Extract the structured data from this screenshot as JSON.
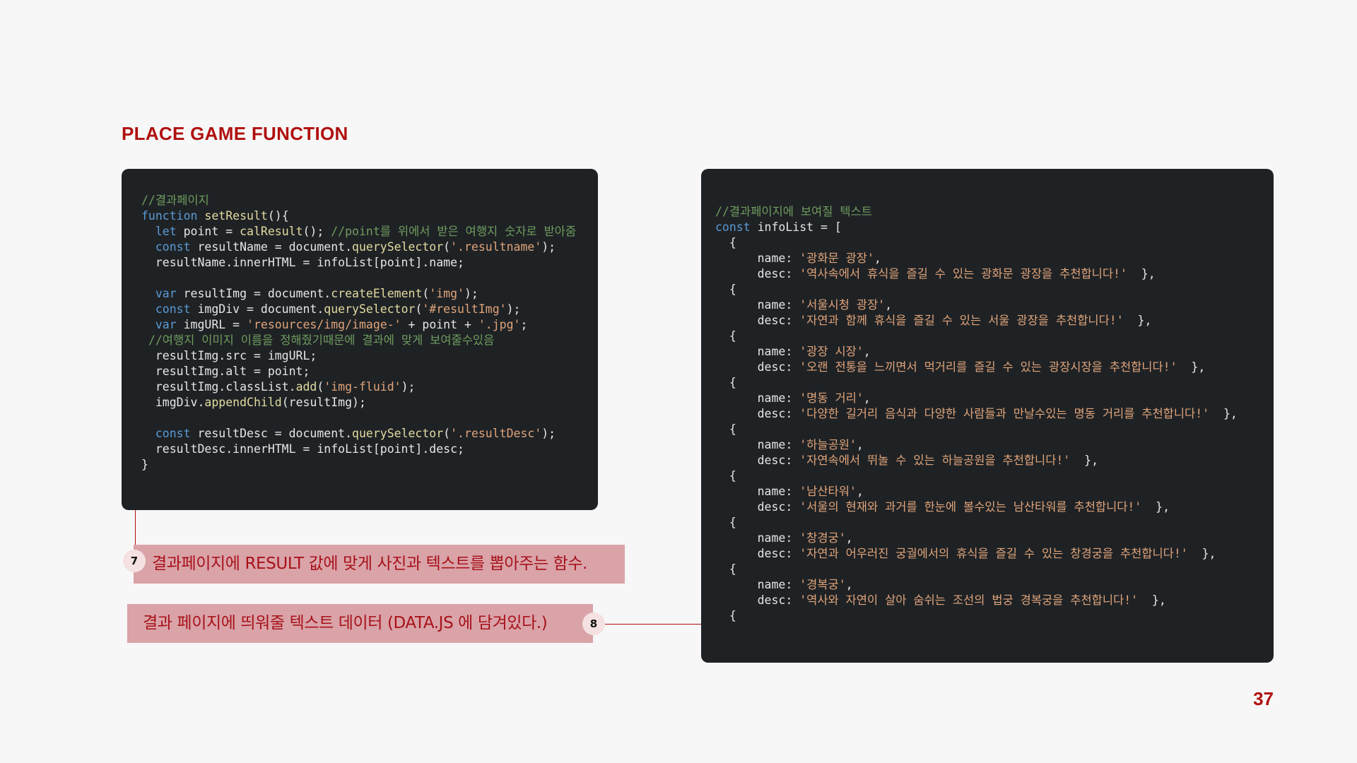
{
  "slide": {
    "title": "PLACE GAME FUNCTION",
    "page_number": "37",
    "accent_color": "#b01010",
    "panel_color": "#1f2225",
    "callout_color": "#d9a3a8"
  },
  "left_code": {
    "l1": "//결과페이지",
    "l2_kw": "function",
    "l2_fn": "setResult",
    "l2_rest": "(){",
    "l3_kw": "let",
    "l3_a": " point = ",
    "l3_fn": "calResult",
    "l3_b": "(); ",
    "l3_cm": "//point를 위에서 받은 여행지 숫자로 받아줌",
    "l4_kw": "const",
    "l4_a": " resultName = document.",
    "l4_fn": "querySelector",
    "l4_b": "(",
    "l4_st": "'.resultname'",
    "l4_c": ");",
    "l5": "resultName.innerHTML = infoList[point].name;",
    "l7_kw": "var",
    "l7_a": " resultImg = document.",
    "l7_fn": "createElement",
    "l7_b": "(",
    "l7_st": "'img'",
    "l7_c": ");",
    "l8_kw": "const",
    "l8_a": " imgDiv = document.",
    "l8_fn": "querySelector",
    "l8_b": "(",
    "l8_st": "'#resultImg'",
    "l8_c": ");",
    "l9_kw": "var",
    "l9_a": " imgURL = ",
    "l9_st": "'resources/img/image-'",
    "l9_b": " + point + ",
    "l9_st2": "'.jpg'",
    "l9_c": ";",
    "l10": "//여행지 이미지 이름을 정해줬기때문에 결과에 맞게 보여줄수있음",
    "l11": "resultImg.src = imgURL;",
    "l12": "resultImg.alt = point;",
    "l13_a": "resultImg.classList.",
    "l13_fn": "add",
    "l13_b": "(",
    "l13_st": "'img-fluid'",
    "l13_c": ");",
    "l14_a": "imgDiv.",
    "l14_fn": "appendChild",
    "l14_b": "(resultImg);",
    "l16_kw": "const",
    "l16_a": " resultDesc = document.",
    "l16_fn": "querySelector",
    "l16_b": "(",
    "l16_st": "'.resultDesc'",
    "l16_c": ");",
    "l17": "resultDesc.innerHTML = infoList[point].desc;",
    "l18": "}"
  },
  "right_code": {
    "comment": "//결과페이지에 보여질 텍스트",
    "decl_kw": "const",
    "decl_rest": " infoList = [",
    "open_brace": "{",
    "name_key": "name: ",
    "desc_key": "desc: ",
    "close_suffix": "  },",
    "items": [
      {
        "name": "'광화문 광장'",
        "desc": "'역사속에서 휴식을 즐길 수 있는 광화문 광장을 추천합니다!'"
      },
      {
        "name": "'서울시청 광장'",
        "desc": "'자연과 함께 휴식을 즐길 수 있는 서울 광장을 추천합니다!'"
      },
      {
        "name": "'광장 시장'",
        "desc": "'오랜 전통을 느끼면서 먹거리를 즐길 수 있는 광장시장을 추천합니다!'"
      },
      {
        "name": "'명동 거리'",
        "desc": "'다양한 길거리 음식과 다양한 사람들과 만날수있는 명동 거리를 추천합니다!'"
      },
      {
        "name": "'하늘공원'",
        "desc": "'자연속에서 뛰놀 수 있는 하늘공원을 추천합니다!'"
      },
      {
        "name": "'남산타워'",
        "desc": "'서울의 현재와 과거를 한눈에 볼수있는 남산타워를 추천합니다!'"
      },
      {
        "name": "'창경궁'",
        "desc": "'자연과 어우러진 궁궐에서의 휴식을 즐길 수 있는 창경궁을 추천합니다!'"
      },
      {
        "name": "'경복궁'",
        "desc": "'역사와 자연이 살아 숨쉬는 조선의 법궁 경복궁을 추천합니다!'"
      }
    ]
  },
  "callouts": {
    "c7_number": "7",
    "c7_text": "결과페이지에 RESULT 값에 맞게 사진과 텍스트를 뽑아주는 함수.",
    "c8_number": "8",
    "c8_text": "결과 페이지에 띄워줄 텍스트 데이터 (DATA.JS 에 담겨있다.)"
  }
}
